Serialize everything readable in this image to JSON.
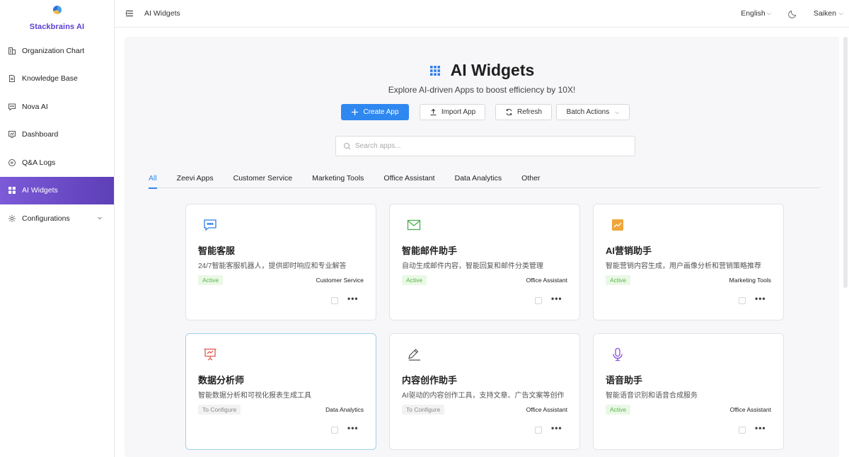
{
  "brand": {
    "name": "Stackbrains AI"
  },
  "sidebar": {
    "items": [
      {
        "label": "Organization Chart",
        "icon": "org-chart-icon"
      },
      {
        "label": "Knowledge Base",
        "icon": "document-icon"
      },
      {
        "label": "Nova AI",
        "icon": "chat-icon"
      },
      {
        "label": "Dashboard",
        "icon": "dashboard-icon"
      },
      {
        "label": "Q&A Logs",
        "icon": "qa-logs-icon"
      },
      {
        "label": "AI Widgets",
        "icon": "widgets-grid-icon",
        "active": true
      },
      {
        "label": "Configurations",
        "icon": "gear-icon",
        "expandable": true
      }
    ]
  },
  "header": {
    "title": "AI Widgets",
    "language": "English",
    "user": "Saiken"
  },
  "hero": {
    "title": "AI Widgets",
    "subtitle": "Explore AI-driven Apps to boost efficiency by 10X!"
  },
  "actions": {
    "create": "Create App",
    "import": "Import App",
    "refresh": "Refresh",
    "batch": "Batch Actions"
  },
  "search": {
    "placeholder": "Search apps..."
  },
  "tabs": [
    {
      "label": "All",
      "active": true
    },
    {
      "label": "Zeevi Apps"
    },
    {
      "label": "Customer Service"
    },
    {
      "label": "Marketing Tools"
    },
    {
      "label": "Office Assistant"
    },
    {
      "label": "Data Analytics"
    },
    {
      "label": "Other"
    }
  ],
  "cards": [
    {
      "name": "智能客服",
      "desc": "24/7智能客服机器人，提供即时响应和专业解答",
      "status": "Active",
      "category": "Customer Service",
      "icon": "chat-bubble-icon",
      "color": "#2f7ee8"
    },
    {
      "name": "智能邮件助手",
      "desc": "自动生成邮件内容，智能回复和邮件分类管理",
      "status": "Active",
      "category": "Office Assistant",
      "icon": "envelope-icon",
      "color": "#4caf50"
    },
    {
      "name": "AI营销助手",
      "desc": "智能营销内容生成，用户画像分析和营销策略推荐",
      "status": "Active",
      "category": "Marketing Tools",
      "icon": "trend-chart-icon",
      "color": "#f0a63a"
    },
    {
      "name": "数据分析师",
      "desc": "智能数据分析和可视化报表生成工具",
      "status": "To Configure",
      "category": "Data Analytics",
      "icon": "presentation-chart-icon",
      "color": "#e05a4f"
    },
    {
      "name": "内容创作助手",
      "desc": "AI驱动的内容创作工具，支持文章、广告文案等创作",
      "status": "To Configure",
      "category": "Office Assistant",
      "icon": "pencil-icon",
      "color": "#555555"
    },
    {
      "name": "语音助手",
      "desc": "智能语音识别和语音合成服务",
      "status": "Active",
      "category": "Office Assistant",
      "icon": "microphone-icon",
      "color": "#8a4fd8"
    }
  ],
  "more_label": "•••"
}
